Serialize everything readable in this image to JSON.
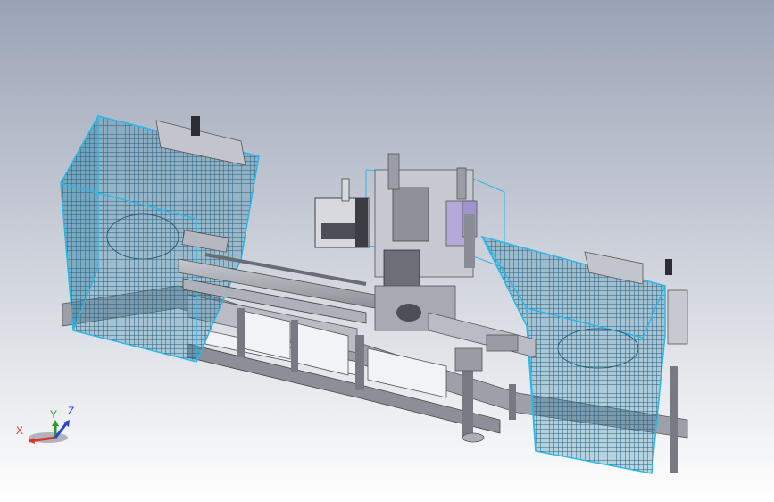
{
  "viewport": {
    "background_top": "#9aa3b6",
    "background_bottom": "#ffffff",
    "model_name": "cad-machine-assembly"
  },
  "colors": {
    "guard_mesh": "#4fb2d6",
    "guard_edge": "#2bb8e8",
    "frame_gray": "#a9acb4",
    "frame_dark": "#6a6d75",
    "panel_light": "#d3d5dc",
    "slot_white": "#f2f3f6"
  },
  "triad": {
    "x_label": "X",
    "y_label": "Y",
    "z_label": "Z",
    "x_color": "#e0302a",
    "y_color": "#2c9a2c",
    "z_color": "#2a3fd8"
  }
}
